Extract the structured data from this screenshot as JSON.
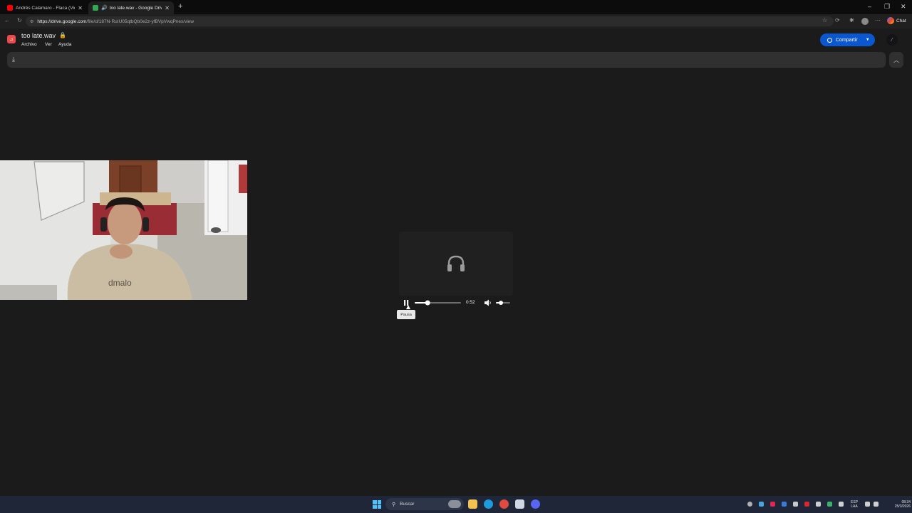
{
  "browser": {
    "tabs": [
      {
        "title": "Andrés Calamaro - Flaca (Videoclip",
        "active": false,
        "favicon_color": "#ff0000"
      },
      {
        "title": "too late.wav - Google Drive",
        "active": true,
        "favicon_color": "#34a853"
      }
    ],
    "new_tab_icon": "plus-icon",
    "address": {
      "host": "https://drive.google.com",
      "path": "/file/d/187N-RuIU05qtbQb0e2z-yfBVpVwqPnex/view"
    },
    "chat_label": "Chat"
  },
  "drive": {
    "file_title": "too late.wav",
    "menu": [
      "Archivo",
      "Ver",
      "Ayuda"
    ],
    "share_label": "Compartir",
    "accent": "#0b57d0"
  },
  "player": {
    "time": "0:52",
    "progress": 0.28,
    "volume": 0.35,
    "tooltip": "Pausa",
    "state": "playing"
  },
  "taskbar": {
    "search_placeholder": "Buscar",
    "lang_top": "ESP",
    "lang_bottom": "LAA",
    "time": "08:34",
    "date": "25/3/2026"
  }
}
